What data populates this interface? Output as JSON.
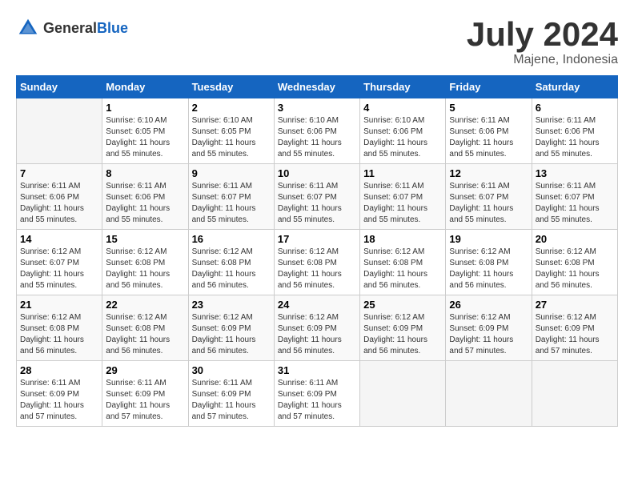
{
  "header": {
    "logo_general": "General",
    "logo_blue": "Blue",
    "month_year": "July 2024",
    "location": "Majene, Indonesia"
  },
  "calendar": {
    "days_of_week": [
      "Sunday",
      "Monday",
      "Tuesday",
      "Wednesday",
      "Thursday",
      "Friday",
      "Saturday"
    ],
    "weeks": [
      [
        {
          "day": "",
          "info": ""
        },
        {
          "day": "1",
          "info": "Sunrise: 6:10 AM\nSunset: 6:05 PM\nDaylight: 11 hours\nand 55 minutes."
        },
        {
          "day": "2",
          "info": "Sunrise: 6:10 AM\nSunset: 6:05 PM\nDaylight: 11 hours\nand 55 minutes."
        },
        {
          "day": "3",
          "info": "Sunrise: 6:10 AM\nSunset: 6:06 PM\nDaylight: 11 hours\nand 55 minutes."
        },
        {
          "day": "4",
          "info": "Sunrise: 6:10 AM\nSunset: 6:06 PM\nDaylight: 11 hours\nand 55 minutes."
        },
        {
          "day": "5",
          "info": "Sunrise: 6:11 AM\nSunset: 6:06 PM\nDaylight: 11 hours\nand 55 minutes."
        },
        {
          "day": "6",
          "info": "Sunrise: 6:11 AM\nSunset: 6:06 PM\nDaylight: 11 hours\nand 55 minutes."
        }
      ],
      [
        {
          "day": "7",
          "info": "Sunrise: 6:11 AM\nSunset: 6:06 PM\nDaylight: 11 hours\nand 55 minutes."
        },
        {
          "day": "8",
          "info": "Sunrise: 6:11 AM\nSunset: 6:06 PM\nDaylight: 11 hours\nand 55 minutes."
        },
        {
          "day": "9",
          "info": "Sunrise: 6:11 AM\nSunset: 6:07 PM\nDaylight: 11 hours\nand 55 minutes."
        },
        {
          "day": "10",
          "info": "Sunrise: 6:11 AM\nSunset: 6:07 PM\nDaylight: 11 hours\nand 55 minutes."
        },
        {
          "day": "11",
          "info": "Sunrise: 6:11 AM\nSunset: 6:07 PM\nDaylight: 11 hours\nand 55 minutes."
        },
        {
          "day": "12",
          "info": "Sunrise: 6:11 AM\nSunset: 6:07 PM\nDaylight: 11 hours\nand 55 minutes."
        },
        {
          "day": "13",
          "info": "Sunrise: 6:11 AM\nSunset: 6:07 PM\nDaylight: 11 hours\nand 55 minutes."
        }
      ],
      [
        {
          "day": "14",
          "info": "Sunrise: 6:12 AM\nSunset: 6:07 PM\nDaylight: 11 hours\nand 55 minutes."
        },
        {
          "day": "15",
          "info": "Sunrise: 6:12 AM\nSunset: 6:08 PM\nDaylight: 11 hours\nand 56 minutes."
        },
        {
          "day": "16",
          "info": "Sunrise: 6:12 AM\nSunset: 6:08 PM\nDaylight: 11 hours\nand 56 minutes."
        },
        {
          "day": "17",
          "info": "Sunrise: 6:12 AM\nSunset: 6:08 PM\nDaylight: 11 hours\nand 56 minutes."
        },
        {
          "day": "18",
          "info": "Sunrise: 6:12 AM\nSunset: 6:08 PM\nDaylight: 11 hours\nand 56 minutes."
        },
        {
          "day": "19",
          "info": "Sunrise: 6:12 AM\nSunset: 6:08 PM\nDaylight: 11 hours\nand 56 minutes."
        },
        {
          "day": "20",
          "info": "Sunrise: 6:12 AM\nSunset: 6:08 PM\nDaylight: 11 hours\nand 56 minutes."
        }
      ],
      [
        {
          "day": "21",
          "info": "Sunrise: 6:12 AM\nSunset: 6:08 PM\nDaylight: 11 hours\nand 56 minutes."
        },
        {
          "day": "22",
          "info": "Sunrise: 6:12 AM\nSunset: 6:08 PM\nDaylight: 11 hours\nand 56 minutes."
        },
        {
          "day": "23",
          "info": "Sunrise: 6:12 AM\nSunset: 6:09 PM\nDaylight: 11 hours\nand 56 minutes."
        },
        {
          "day": "24",
          "info": "Sunrise: 6:12 AM\nSunset: 6:09 PM\nDaylight: 11 hours\nand 56 minutes."
        },
        {
          "day": "25",
          "info": "Sunrise: 6:12 AM\nSunset: 6:09 PM\nDaylight: 11 hours\nand 56 minutes."
        },
        {
          "day": "26",
          "info": "Sunrise: 6:12 AM\nSunset: 6:09 PM\nDaylight: 11 hours\nand 57 minutes."
        },
        {
          "day": "27",
          "info": "Sunrise: 6:12 AM\nSunset: 6:09 PM\nDaylight: 11 hours\nand 57 minutes."
        }
      ],
      [
        {
          "day": "28",
          "info": "Sunrise: 6:11 AM\nSunset: 6:09 PM\nDaylight: 11 hours\nand 57 minutes."
        },
        {
          "day": "29",
          "info": "Sunrise: 6:11 AM\nSunset: 6:09 PM\nDaylight: 11 hours\nand 57 minutes."
        },
        {
          "day": "30",
          "info": "Sunrise: 6:11 AM\nSunset: 6:09 PM\nDaylight: 11 hours\nand 57 minutes."
        },
        {
          "day": "31",
          "info": "Sunrise: 6:11 AM\nSunset: 6:09 PM\nDaylight: 11 hours\nand 57 minutes."
        },
        {
          "day": "",
          "info": ""
        },
        {
          "day": "",
          "info": ""
        },
        {
          "day": "",
          "info": ""
        }
      ]
    ]
  }
}
